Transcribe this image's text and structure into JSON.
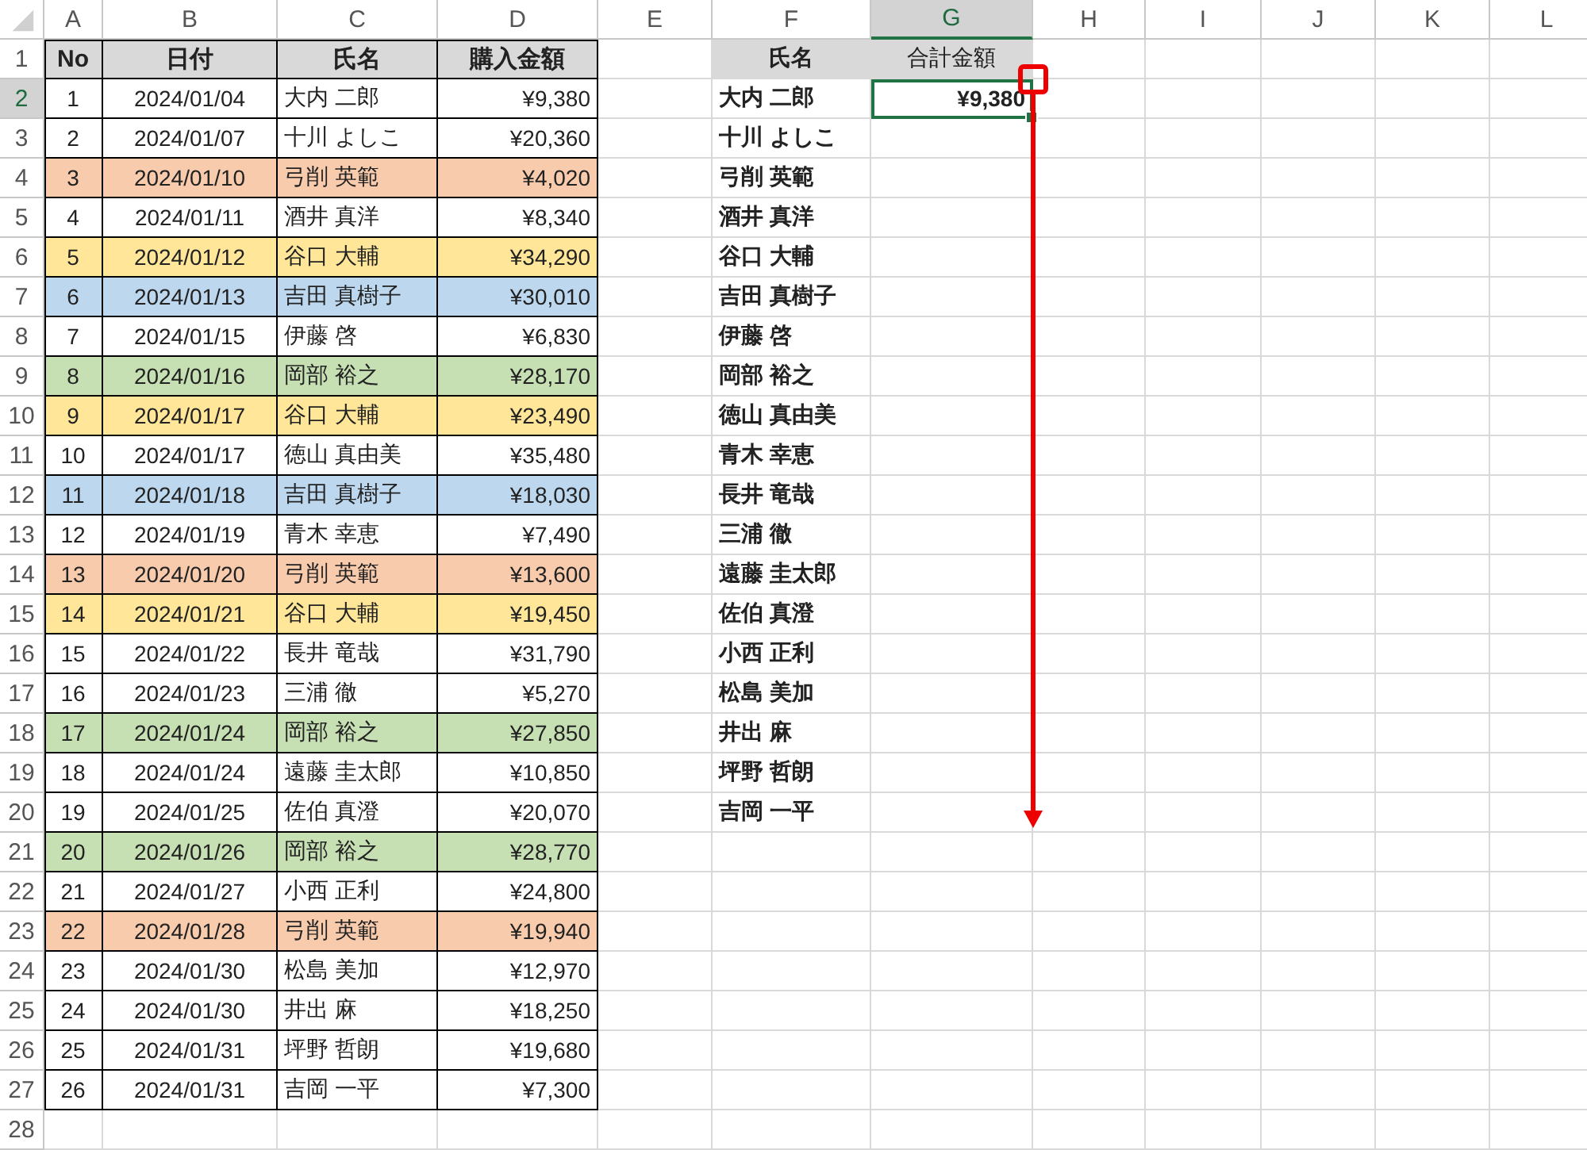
{
  "columns": [
    {
      "label": "A",
      "selected": false
    },
    {
      "label": "B",
      "selected": false
    },
    {
      "label": "C",
      "selected": false
    },
    {
      "label": "D",
      "selected": false
    },
    {
      "label": "E",
      "selected": false
    },
    {
      "label": "F",
      "selected": false
    },
    {
      "label": "G",
      "selected": true
    },
    {
      "label": "H",
      "selected": false
    },
    {
      "label": "I",
      "selected": false
    },
    {
      "label": "J",
      "selected": false
    },
    {
      "label": "K",
      "selected": false
    },
    {
      "label": "L",
      "selected": false
    }
  ],
  "rows": [
    {
      "label": "1",
      "selected": false
    },
    {
      "label": "2",
      "selected": true
    },
    {
      "label": "3",
      "selected": false
    },
    {
      "label": "4",
      "selected": false
    },
    {
      "label": "5",
      "selected": false
    },
    {
      "label": "6",
      "selected": false
    },
    {
      "label": "7",
      "selected": false
    },
    {
      "label": "8",
      "selected": false
    },
    {
      "label": "9",
      "selected": false
    },
    {
      "label": "10",
      "selected": false
    },
    {
      "label": "11",
      "selected": false
    },
    {
      "label": "12",
      "selected": false
    },
    {
      "label": "13",
      "selected": false
    },
    {
      "label": "14",
      "selected": false
    },
    {
      "label": "15",
      "selected": false
    },
    {
      "label": "16",
      "selected": false
    },
    {
      "label": "17",
      "selected": false
    },
    {
      "label": "18",
      "selected": false
    },
    {
      "label": "19",
      "selected": false
    },
    {
      "label": "20",
      "selected": false
    },
    {
      "label": "21",
      "selected": false
    },
    {
      "label": "22",
      "selected": false
    },
    {
      "label": "23",
      "selected": false
    },
    {
      "label": "24",
      "selected": false
    },
    {
      "label": "25",
      "selected": false
    },
    {
      "label": "26",
      "selected": false
    },
    {
      "label": "27",
      "selected": false
    },
    {
      "label": "28",
      "selected": false
    }
  ],
  "purchase_table": {
    "headers": [
      "No",
      "日付",
      "氏名",
      "購入金額"
    ],
    "rows": [
      {
        "no": "1",
        "date": "2024/01/04",
        "name": "大内 二郎",
        "amount": "¥9,380"
      },
      {
        "no": "2",
        "date": "2024/01/07",
        "name": "十川 よしこ",
        "amount": "¥20,360"
      },
      {
        "no": "3",
        "date": "2024/01/10",
        "name": "弓削 英範",
        "amount": "¥4,020",
        "color": "#f8cbad"
      },
      {
        "no": "4",
        "date": "2024/01/11",
        "name": "酒井 真洋",
        "amount": "¥8,340"
      },
      {
        "no": "5",
        "date": "2024/01/12",
        "name": "谷口 大輔",
        "amount": "¥34,290",
        "color": "#ffe699"
      },
      {
        "no": "6",
        "date": "2024/01/13",
        "name": "吉田 真樹子",
        "amount": "¥30,010",
        "color": "#bdd7ee"
      },
      {
        "no": "7",
        "date": "2024/01/15",
        "name": "伊藤 啓",
        "amount": "¥6,830"
      },
      {
        "no": "8",
        "date": "2024/01/16",
        "name": "岡部 裕之",
        "amount": "¥28,170",
        "color": "#c6e0b4"
      },
      {
        "no": "9",
        "date": "2024/01/17",
        "name": "谷口 大輔",
        "amount": "¥23,490",
        "color": "#ffe699"
      },
      {
        "no": "10",
        "date": "2024/01/17",
        "name": "徳山 真由美",
        "amount": "¥35,480"
      },
      {
        "no": "11",
        "date": "2024/01/18",
        "name": "吉田 真樹子",
        "amount": "¥18,030",
        "color": "#bdd7ee"
      },
      {
        "no": "12",
        "date": "2024/01/19",
        "name": "青木 幸恵",
        "amount": "¥7,490"
      },
      {
        "no": "13",
        "date": "2024/01/20",
        "name": "弓削 英範",
        "amount": "¥13,600",
        "color": "#f8cbad"
      },
      {
        "no": "14",
        "date": "2024/01/21",
        "name": "谷口 大輔",
        "amount": "¥19,450",
        "color": "#ffe699"
      },
      {
        "no": "15",
        "date": "2024/01/22",
        "name": "長井 竜哉",
        "amount": "¥31,790"
      },
      {
        "no": "16",
        "date": "2024/01/23",
        "name": "三浦 徹",
        "amount": "¥5,270"
      },
      {
        "no": "17",
        "date": "2024/01/24",
        "name": "岡部 裕之",
        "amount": "¥27,850",
        "color": "#c6e0b4"
      },
      {
        "no": "18",
        "date": "2024/01/24",
        "name": "遠藤 圭太郎",
        "amount": "¥10,850"
      },
      {
        "no": "19",
        "date": "2024/01/25",
        "name": "佐伯 真澄",
        "amount": "¥20,070"
      },
      {
        "no": "20",
        "date": "2024/01/26",
        "name": "岡部 裕之",
        "amount": "¥28,770",
        "color": "#c6e0b4"
      },
      {
        "no": "21",
        "date": "2024/01/27",
        "name": "小西 正利",
        "amount": "¥24,800"
      },
      {
        "no": "22",
        "date": "2024/01/28",
        "name": "弓削 英範",
        "amount": "¥19,940",
        "color": "#f8cbad"
      },
      {
        "no": "23",
        "date": "2024/01/30",
        "name": "松島 美加",
        "amount": "¥12,970"
      },
      {
        "no": "24",
        "date": "2024/01/30",
        "name": "井出 麻",
        "amount": "¥18,250"
      },
      {
        "no": "25",
        "date": "2024/01/31",
        "name": "坪野 哲朗",
        "amount": "¥19,680"
      },
      {
        "no": "26",
        "date": "2024/01/31",
        "name": "吉岡 一平",
        "amount": "¥7,300"
      }
    ]
  },
  "summary": {
    "headers": [
      "氏名",
      "合計金額"
    ],
    "rows": [
      {
        "name": "大内 二郎",
        "total": "¥9,380",
        "selected": true
      },
      {
        "name": "十川 よしこ",
        "selected": false
      },
      {
        "name": "弓削 英範",
        "selected": false
      },
      {
        "name": "酒井 真洋",
        "selected": false
      },
      {
        "name": "谷口 大輔",
        "selected": false
      },
      {
        "name": "吉田 真樹子",
        "selected": false
      },
      {
        "name": "伊藤 啓",
        "selected": false
      },
      {
        "name": "岡部 裕之",
        "selected": false
      },
      {
        "name": "徳山 真由美",
        "selected": false
      },
      {
        "name": "青木 幸恵",
        "selected": false
      },
      {
        "name": "長井 竜哉",
        "selected": false
      },
      {
        "name": "三浦 徹",
        "selected": false
      },
      {
        "name": "遠藤 圭太郎",
        "selected": false
      },
      {
        "name": "佐伯 真澄",
        "selected": false
      },
      {
        "name": "小西 正利",
        "selected": false
      },
      {
        "name": "松島 美加",
        "selected": false
      },
      {
        "name": "井出 麻",
        "selected": false
      },
      {
        "name": "坪野 哲朗",
        "selected": false
      },
      {
        "name": "吉岡 一平",
        "selected": false
      }
    ]
  }
}
